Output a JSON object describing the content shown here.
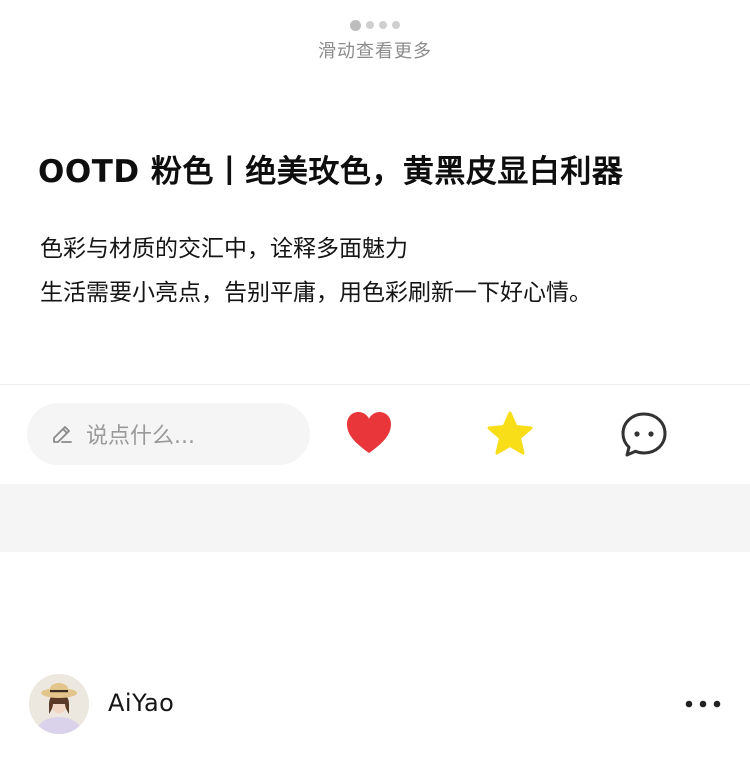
{
  "pager": {
    "hint": "滑动查看更多",
    "total": 4,
    "active_index": 0
  },
  "post": {
    "title": "OOTD 粉色丨绝美玫色，黄黑皮显白利器",
    "lines": [
      "色彩与材质的交汇中，诠释多面魅力",
      "生活需要小亮点，告别平庸，用色彩刷新一下好心情。"
    ]
  },
  "action_bar": {
    "comment_placeholder": "说点什么...",
    "icons": {
      "edit": "pencil-icon",
      "like": "heart-icon",
      "favorite": "star-icon",
      "comment": "chat-bubble-icon"
    },
    "colors": {
      "like": "#e8363a",
      "favorite": "#f7de18"
    }
  },
  "author": {
    "name": "AiYao",
    "avatar_icon": "avatar",
    "menu_icon": "more-dots-icon"
  }
}
